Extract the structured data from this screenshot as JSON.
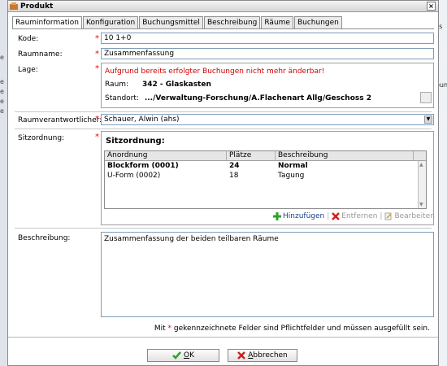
{
  "window": {
    "title": "Produkt",
    "close": "×"
  },
  "tabs": [
    "Rauminformation",
    "Konfiguration",
    "Buchungsmittel",
    "Beschreibung",
    "Räume",
    "Buchungen"
  ],
  "form": {
    "kode_label": "Kode:",
    "kode_value": "10 1+0",
    "raumname_label": "Raumname:",
    "raumname_value": "Zusammenfassung",
    "lage_label": "Lage:",
    "lage_warning": "Aufgrund bereits erfolgter Buchungen nicht mehr änderbar!",
    "raum_label": "Raum:",
    "raum_value": "342 - Glaskasten",
    "standort_label": "Standort:",
    "standort_value": ".../Verwaltung-Forschung/A.Flachenart Allg/Geschoss 2",
    "verantwortlicher_label": "Raumverantwortlicher:",
    "verantwortlicher_value": "Schauer, Alwin (ahs)",
    "sitzordnung_label": "Sitzordnung:",
    "sitzordnung_title": "Sitzordnung:",
    "beschreibung_label": "Beschreibung:",
    "beschreibung_value": "Zusammenfassung der beiden teilbaren Räume",
    "required_mark": "*"
  },
  "grid": {
    "headers": [
      "Anordnung",
      "Plätze",
      "Beschreibung"
    ],
    "rows": [
      {
        "anordnung": "Blockform (0001)",
        "plaetze": "24",
        "beschreibung": "Normal",
        "bold": true
      },
      {
        "anordnung": "U-Form (0002)",
        "plaetze": "18",
        "beschreibung": "Tagung",
        "bold": false
      }
    ]
  },
  "grid_actions": {
    "add": "Hinzufügen",
    "remove": "Entfernen",
    "edit": "Bearbeiten"
  },
  "footer": {
    "note_prefix": "Mit",
    "note_star": "*",
    "note_suffix": "gekennzeichnete Felder sind Pflichtfelder und müssen ausgefüllt sein.",
    "ok_prefix": "O",
    "ok_rest": "K",
    "cancel_prefix": "A",
    "cancel_rest": "bbrechen"
  },
  "background": {
    "right_fragment_1": "ss",
    "right_fragment_2": "oun"
  },
  "colors": {
    "warning": "#d00000",
    "add_green": "#2aa52a",
    "cancel_red": "#d02020"
  }
}
